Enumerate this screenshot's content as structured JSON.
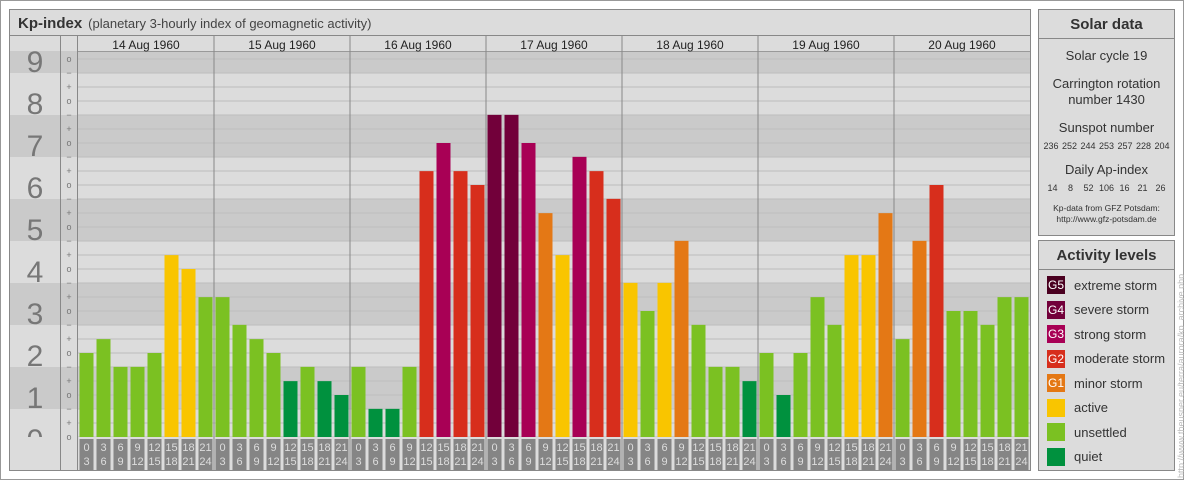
{
  "header": {
    "title": "Kp-index",
    "subtitle": "(planetary 3-hourly index of geomagnetic activity)"
  },
  "chart_data": {
    "type": "bar",
    "title": "Kp-index",
    "ylabel": "Kp",
    "ylim": [
      0,
      9
    ],
    "y_ticks": [
      "0",
      "1",
      "2",
      "3",
      "4",
      "5",
      "6",
      "7",
      "8",
      "9"
    ],
    "minor_tick_labels": {
      "minus": "−",
      "zero": "o",
      "plus": "+"
    },
    "days": [
      "14 Aug 1960",
      "15 Aug 1960",
      "16 Aug 1960",
      "17 Aug 1960",
      "18 Aug 1960",
      "19 Aug 1960",
      "20 Aug 1960"
    ],
    "hour_intervals": [
      [
        "0",
        "3"
      ],
      [
        "3",
        "6"
      ],
      [
        "6",
        "9"
      ],
      [
        "9",
        "12"
      ],
      [
        "12",
        "15"
      ],
      [
        "15",
        "18"
      ],
      [
        "18",
        "21"
      ],
      [
        "21",
        "24"
      ]
    ],
    "values": [
      [
        2,
        2.33,
        1.67,
        1.67,
        2,
        4.33,
        4,
        3.33
      ],
      [
        3.33,
        2.67,
        2.33,
        2,
        1.33,
        1.67,
        1.33,
        1
      ],
      [
        1.67,
        0.67,
        0.67,
        1.67,
        6.33,
        7,
        6.33,
        6
      ],
      [
        7.67,
        7.67,
        7,
        5.33,
        4.33,
        6.67,
        6.33,
        5.67
      ],
      [
        3.67,
        3,
        3.67,
        4.67,
        2.67,
        1.67,
        1.67,
        1.33
      ],
      [
        2,
        1,
        2,
        3.33,
        2.67,
        4.33,
        4.33,
        5.33
      ],
      [
        2.33,
        4.67,
        6,
        3,
        3,
        2.67,
        3.33,
        3.33
      ]
    ]
  },
  "colors": {
    "G5": "#4a0020",
    "G4": "#72003a",
    "G3": "#a80055",
    "G2": "#d72e1c",
    "G1": "#e47815",
    "active": "#f9c500",
    "unsettled": "#7bc122",
    "quiet": "#00913e"
  },
  "solar": {
    "title": "Solar data",
    "cycle": "Solar cycle 19",
    "carrington_1": "Carrington rotation",
    "carrington_2": "number 1430",
    "sunspot_label": "Sunspot number",
    "sunspots": "236 252 244 253 257 228 204",
    "ap_label": "Daily Ap-index",
    "ap": [
      "14",
      "8",
      "52",
      "106",
      "16",
      "21",
      "26"
    ],
    "source_1": "Kp-data from GFZ Potsdam:",
    "source_2": "http://www.gfz-potsdam.de"
  },
  "legend": {
    "title": "Activity levels",
    "items": [
      {
        "code": "G5",
        "label": "extreme storm",
        "key": "G5"
      },
      {
        "code": "G4",
        "label": "severe storm",
        "key": "G4"
      },
      {
        "code": "G3",
        "label": "strong storm",
        "key": "G3"
      },
      {
        "code": "G2",
        "label": "moderate storm",
        "key": "G2"
      },
      {
        "code": "G1",
        "label": "minor storm",
        "key": "G1"
      },
      {
        "code": "",
        "label": "active",
        "key": "active"
      },
      {
        "code": "",
        "label": "unsettled",
        "key": "unsettled"
      },
      {
        "code": "",
        "label": "quiet",
        "key": "quiet"
      }
    ]
  },
  "watermark": "http://www.theusner.eu/terra/aurora/kp_archive.php"
}
